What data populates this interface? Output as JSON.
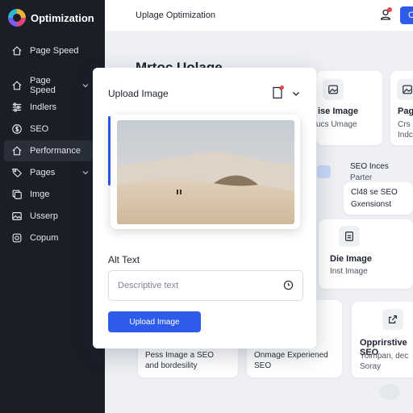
{
  "sidebar": {
    "brand": "Optimization",
    "items": [
      {
        "label": "Page Speed",
        "icon": "home-icon",
        "chevron": false
      },
      {
        "label": "Page Speed",
        "icon": "home-icon",
        "chevron": true
      },
      {
        "label": "Indlers",
        "icon": "sliders-icon",
        "chevron": false
      },
      {
        "label": "SEO",
        "icon": "dollar-icon",
        "chevron": false
      },
      {
        "label": "Performance",
        "icon": "home-icon",
        "chevron": false,
        "active": true
      },
      {
        "label": "Pages",
        "icon": "tag-icon",
        "chevron": true
      },
      {
        "label": "Imge",
        "icon": "copy-icon",
        "chevron": false
      },
      {
        "label": "Usserp",
        "icon": "image-icon",
        "chevron": false
      },
      {
        "label": "Copum",
        "icon": "camera-icon",
        "chevron": false
      }
    ]
  },
  "topbar": {
    "title": "Uplage Optimization",
    "button_label": "C"
  },
  "background": {
    "heading": "Mrtoc Uolage",
    "card1": {
      "title": "ise Image",
      "sub": "ucs Umage"
    },
    "card2": {
      "title": "Pag",
      "sub1": "Crs",
      "sub2": "Indc"
    },
    "seo": {
      "title": "SEO Inces",
      "sub": "Parter",
      "line1": "Cl48 se SEO",
      "line2": "Gxensionst"
    },
    "card3": {
      "title": "Die Image",
      "sub": "Inst Image"
    },
    "card4": {
      "line1": "Pess Image a SEO",
      "line2": "and bordesility"
    },
    "card5": {
      "line1": "Onmage Experiened",
      "line2": "SEO"
    },
    "card6": {
      "title": "Opprirstive SEO",
      "line1": "Yoimpan, dec",
      "line2": "Soray"
    }
  },
  "modal": {
    "title": "Upload Image",
    "alt_label": "Alt Text",
    "alt_placeholder": "Descriptive text",
    "upload_button": "Upload Image"
  },
  "colors": {
    "sidebar_bg": "#1a1e27",
    "accent": "#2f5bea",
    "notification": "#e5484d",
    "page_bg": "#eef0f4"
  }
}
